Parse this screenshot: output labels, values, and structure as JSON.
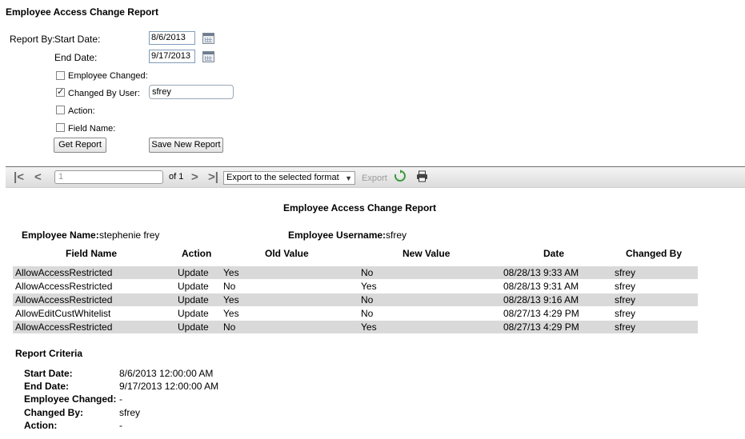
{
  "page": {
    "title": "Employee Access Change Report"
  },
  "filters": {
    "report_by_label": "Report By:",
    "start_date_label": "Start Date:",
    "start_date_value": "8/6/2013",
    "end_date_label": "End Date:",
    "end_date_value": "9/17/2013",
    "employee_changed_label": "Employee Changed:",
    "employee_changed_checked": false,
    "changed_by_user_label": "Changed By User:",
    "changed_by_user_checked": true,
    "changed_by_user_value": "sfrey",
    "action_label": "Action:",
    "action_checked": false,
    "field_name_label": "Field Name:",
    "field_name_checked": false,
    "get_report_label": "Get Report",
    "save_new_report_label": "Save New Report"
  },
  "toolbar": {
    "page_input_placeholder": "1",
    "page_of": "of 1",
    "export_format": "Export to the selected format",
    "export_label": "Export"
  },
  "report": {
    "title": "Employee Access Change Report",
    "employee_name_label": "Employee Name:",
    "employee_name_value": "stephenie frey",
    "employee_username_label": "Employee Username:",
    "employee_username_value": "sfrey",
    "columns": [
      "Field Name",
      "Action",
      "Old Value",
      "New Value",
      "Date",
      "Changed By"
    ],
    "rows": [
      [
        "AllowAccessRestricted",
        "Update",
        "Yes",
        "No",
        "08/28/13 9:33 AM",
        "sfrey"
      ],
      [
        "AllowAccessRestricted",
        "Update",
        "No",
        "Yes",
        "08/28/13 9:31 AM",
        "sfrey"
      ],
      [
        "AllowAccessRestricted",
        "Update",
        "Yes",
        "No",
        "08/28/13 9:16 AM",
        "sfrey"
      ],
      [
        "AllowEditCustWhitelist",
        "Update",
        "Yes",
        "No",
        "08/27/13 4:29 PM",
        "sfrey"
      ],
      [
        "AllowAccessRestricted",
        "Update",
        "No",
        "Yes",
        "08/27/13 4:29 PM",
        "sfrey"
      ]
    ]
  },
  "criteria": {
    "title": "Report Criteria",
    "items": [
      {
        "label": "Start Date:",
        "value": "8/6/2013 12:00:00 AM"
      },
      {
        "label": "End Date:",
        "value": "9/17/2013 12:00:00 AM"
      },
      {
        "label": "Employee Changed:",
        "value": "-"
      },
      {
        "label": "Changed By:",
        "value": "sfrey"
      },
      {
        "label": "Action:",
        "value": "-"
      }
    ]
  },
  "colors": {
    "row_alt": "#d9d9d9",
    "refresh_icon": "#3a9a3a"
  },
  "icons": [
    "calendar-icon",
    "first-page-icon",
    "previous-page-icon",
    "next-page-icon",
    "last-page-icon",
    "refresh-icon",
    "print-icon",
    "dropdown-arrow-icon"
  ]
}
